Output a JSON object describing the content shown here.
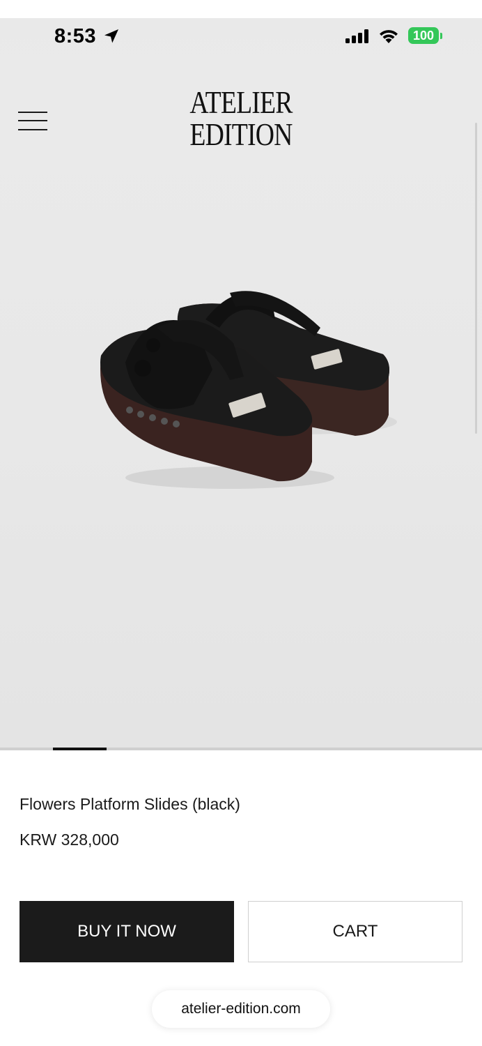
{
  "status_bar": {
    "time": "8:53",
    "battery": "100"
  },
  "header": {
    "logo_line1": "ATELIER",
    "logo_line2": "EDITION"
  },
  "gallery": {
    "slide_progress": "1 of 9",
    "image": "black-flower-platform-slides"
  },
  "product": {
    "name": "Flowers Platform Slides (black)",
    "price": "KRW 328,000"
  },
  "actions": {
    "buy_label": "BUY IT NOW",
    "cart_label": "CART"
  },
  "browser": {
    "url": "atelier-edition.com"
  },
  "colors": {
    "accent_dark": "#1b1b1b",
    "battery_green": "#34c759",
    "background": "#e9e9e9"
  }
}
